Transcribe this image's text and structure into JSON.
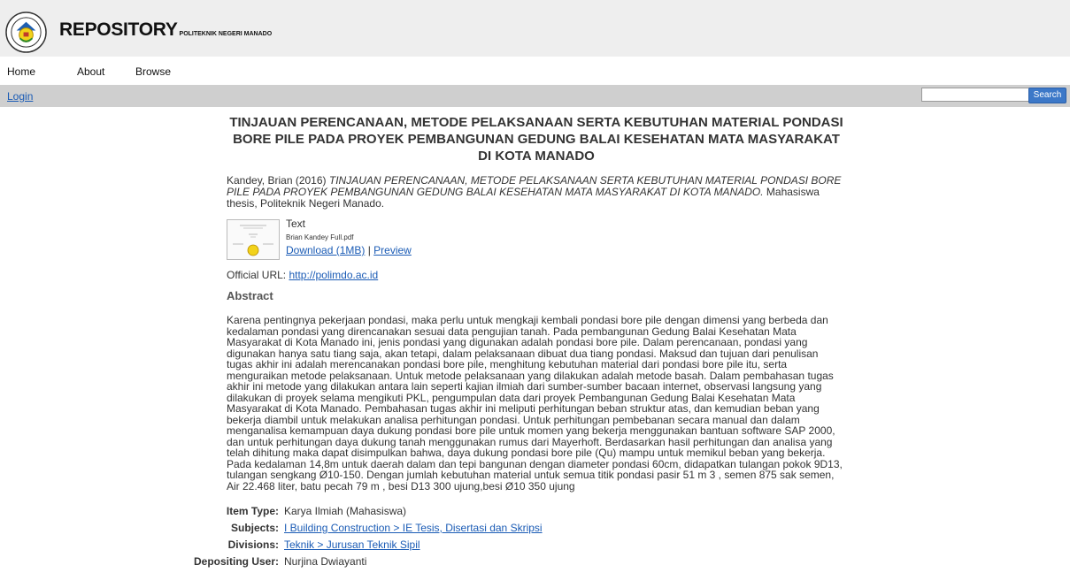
{
  "header": {
    "title": "REPOSITORY",
    "subtitle": "POLITEKNIK NEGERI MANADO"
  },
  "nav": {
    "items": [
      "Home",
      "About",
      "Browse"
    ]
  },
  "toolbar": {
    "login": "Login",
    "search_label": "Search",
    "search_value": ""
  },
  "item": {
    "title": "TINJAUAN PERENCANAAN, METODE PELAKSANAAN SERTA KEBUTUHAN MATERIAL PONDASI BORE PILE PADA PROYEK PEMBANGUNAN GEDUNG BALAI KESEHATAN MATA MASYARAKAT DI KOTA MANADO",
    "citation_pre": "Kandey, Brian (2016) ",
    "citation_title": "TINJAUAN PERENCANAAN, METODE PELAKSANAAN SERTA KEBUTUHAN MATERIAL PONDASI BORE PILE PADA PROYEK PEMBANGUNAN GEDUNG BALAI KESEHATAN MATA MASYARAKAT DI KOTA MANADO.",
    "citation_post": " Mahasiswa thesis, Politeknik Negeri Manado.",
    "document": {
      "type": "Text",
      "filename": "Brian Kandey Full.pdf",
      "download": "Download (1MB)",
      "separator": " | ",
      "preview": "Preview"
    },
    "official_label": "Official URL: ",
    "official_url": "http://polimdo.ac.id",
    "abstract_heading": "Abstract",
    "abstract": "Karena pentingnya pekerjaan pondasi, maka perlu untuk mengkaji kembali pondasi bore pile dengan dimensi yang berbeda dan kedalaman pondasi yang direncanakan sesuai data pengujian tanah. Pada pembangunan Gedung Balai Kesehatan Mata Masyarakat di Kota Manado ini, jenis pondasi yang digunakan adalah pondasi bore pile. Dalam perencanaan, pondasi yang digunakan hanya satu tiang saja, akan tetapi, dalam pelaksanaan dibuat dua tiang pondasi.  Maksud dan tujuan dari penulisan tugas akhir ini adalah merencanakan pondasi bore pile, menghitung kebutuhan material dari pondasi bore pile itu, serta  menguraikan metode pelaksanaan. Untuk metode pelaksanaan yang dilakukan adalah metode basah. Dalam pembahasan tugas akhir ini metode yang dilakukan antara lain seperti kajian ilmiah dari sumber-sumber bacaan internet, observasi langsung yang dilakukan di proyek selama mengikuti PKL, pengumpulan data dari proyek Pembangunan Gedung Balai Kesehatan Mata Masyarakat di Kota Manado.  Pembahasan tugas akhir ini meliputi perhitungan beban struktur atas, dan kemudian beban yang bekerja diambil untuk melakukan analisa perhitungan pondasi. Untuk perhitungan pembebanan secara manual dan dalam menganalisa kemampuan daya dukung pondasi bore pile untuk momen yang bekerja menggunakan bantuan software SAP 2000, dan untuk perhitungan daya dukung tanah menggunakan rumus dari Mayerhoft.  Berdasarkan hasil perhitungan dan analisa yang telah dihitung maka dapat disimpulkan bahwa, daya dukung pondasi bore pile (Qu) mampu untuk memikul beban yang bekerja. Pada kedalaman 14,8m untuk daerah dalam dan tepi bangunan dengan diameter pondasi 60cm, didapatkan tulangan pokok 9D13, tulangan sengkang Ø10-150. Dengan jumlah kebutuhan material untuk semua titik pondasi pasir 51 m 3 , semen 875 sak semen, Air 22.468 liter, batu pecah 79 m , besi D13 300 ujung,besi Ø10 350 ujung",
    "metadata": [
      {
        "label": "Item Type:",
        "value": "Karya Ilmiah (Mahasiswa)",
        "link": false
      },
      {
        "label": "Subjects:",
        "value": "I Building Construction > IE Tesis, Disertasi dan Skripsi",
        "link": true
      },
      {
        "label": "Divisions:",
        "value": "Teknik > Jurusan Teknik Sipil",
        "link": true
      },
      {
        "label": "Depositing User:",
        "value": "Nurjina Dwiayanti",
        "link": false
      }
    ]
  },
  "colors": {
    "link": "#1a5bb5",
    "header_bg": "#eeeeee",
    "toolbar_bg": "#cfcfcf",
    "search_button": "#3c78c8"
  }
}
